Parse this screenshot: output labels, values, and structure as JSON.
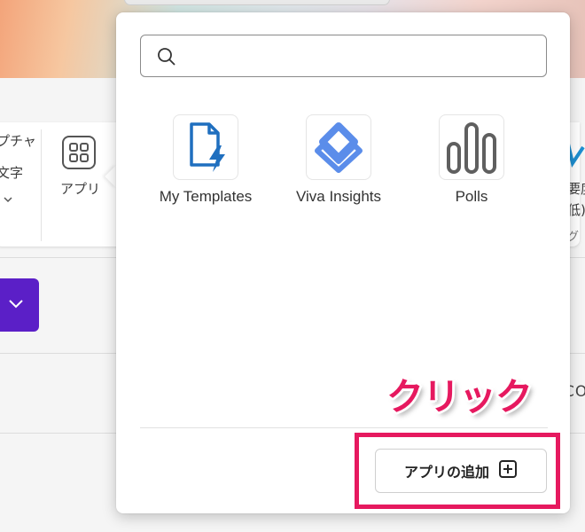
{
  "background": {
    "ribbon_left_labels": [
      "プチャ",
      "文字"
    ],
    "apps_button_label": "アプリ",
    "ribbon_right_labels": [
      "要度",
      "低)",
      "グ"
    ],
    "partial_right_text": "CO"
  },
  "flyout": {
    "search": {
      "placeholder": "",
      "value": ""
    },
    "apps": [
      {
        "label": "My Templates",
        "icon": "my-templates-icon",
        "color": "#1f6fbf"
      },
      {
        "label": "Viva Insights",
        "icon": "viva-insights-icon",
        "color": "#5b8dea"
      },
      {
        "label": "Polls",
        "icon": "polls-icon",
        "color": "#5f5f5f"
      }
    ],
    "add_app_button": {
      "label": "アプリの追加",
      "icon": "plus-box-icon"
    }
  },
  "annotation": {
    "callout_text": "クリック",
    "color": "#e6195f"
  },
  "colors": {
    "accent_purple": "#5b1fc7",
    "highlight": "#e6195f"
  }
}
